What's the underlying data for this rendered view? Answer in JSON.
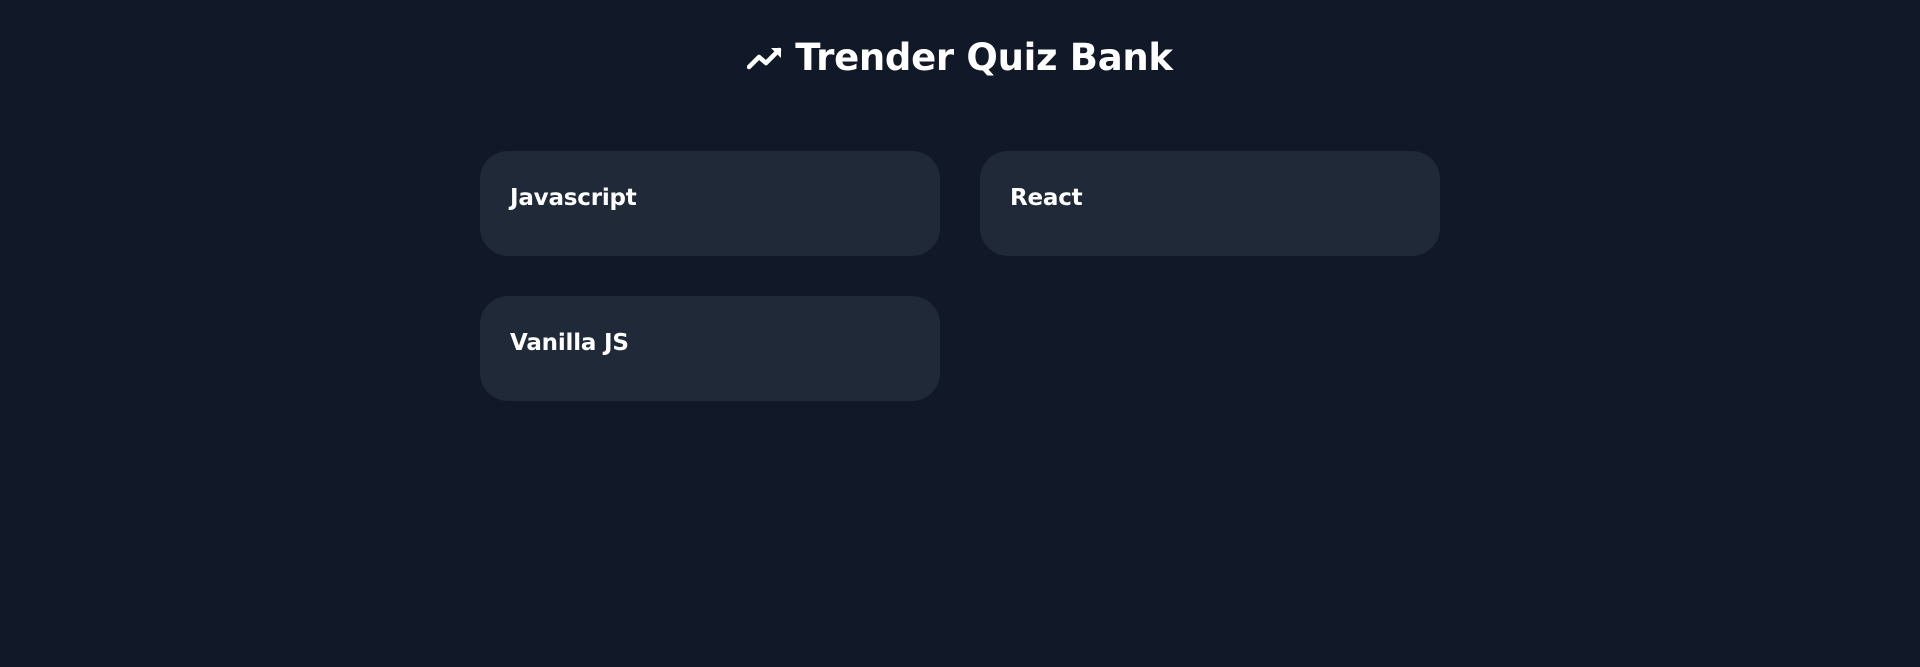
{
  "header": {
    "title": "Trender Quiz Bank",
    "icon": "trending-up-icon"
  },
  "quizzes": [
    {
      "label": "Javascript"
    },
    {
      "label": "React"
    },
    {
      "label": "Vanilla JS"
    }
  ],
  "colors": {
    "background": "#111827",
    "card": "#1f2937",
    "text": "#ffffff"
  }
}
